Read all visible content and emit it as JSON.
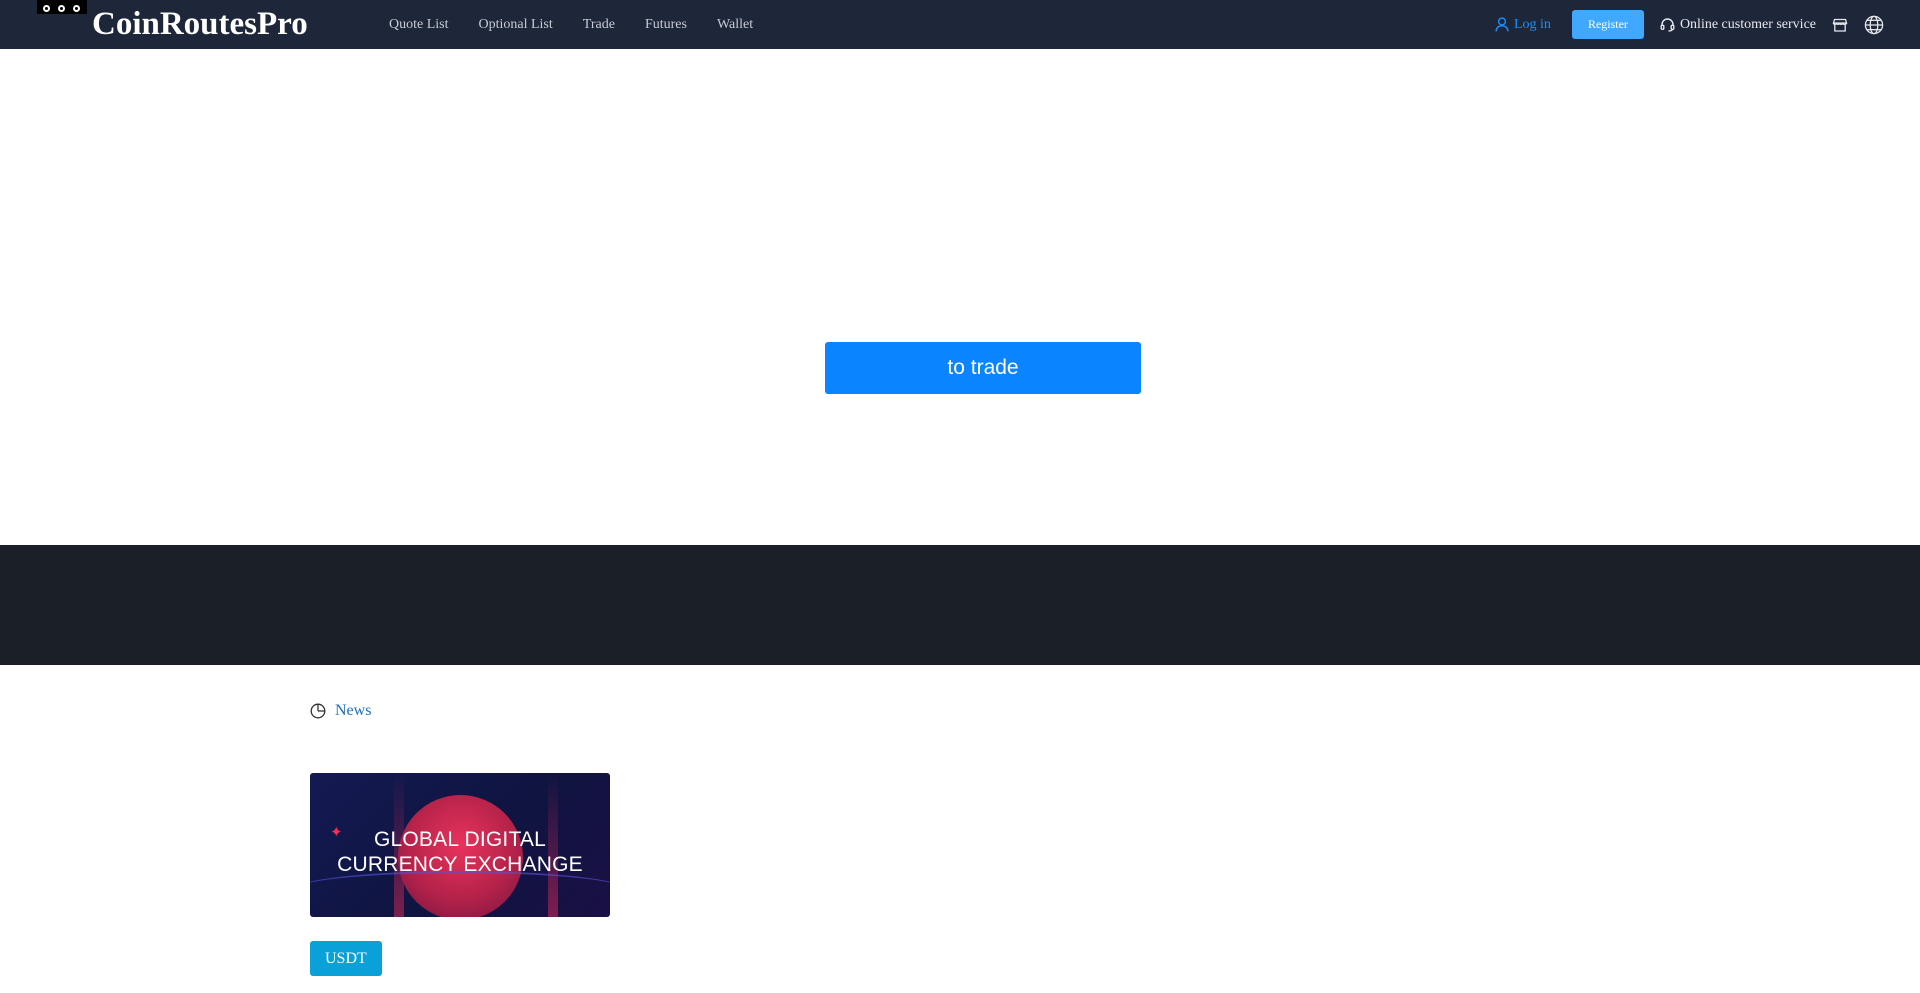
{
  "header": {
    "brand": "CoinRoutesPro",
    "nav": [
      {
        "label": "Quote List"
      },
      {
        "label": "Optional List"
      },
      {
        "label": "Trade"
      },
      {
        "label": "Futures"
      },
      {
        "label": "Wallet"
      }
    ],
    "login_label": "Log in",
    "register_label": "Register",
    "service_label": "Online customer service",
    "icons": {
      "user": "user-icon",
      "headset": "headset-icon",
      "store": "store-icon",
      "language": "globe-icon"
    }
  },
  "hero": {
    "cta_label": "to trade"
  },
  "news": {
    "title": "News",
    "icon": "clock-icon",
    "card": {
      "headline_line1": "GLOBAL DIGITAL",
      "headline_line2": "CURRENCY EXCHANGE"
    },
    "tag_label": "USDT"
  },
  "colors": {
    "header_bg": "#1e2639",
    "accent_blue": "#1890ff",
    "cta_blue": "#0a84ff",
    "dark_band": "#1b1f27",
    "tag_blue": "#0aa0d8",
    "news_link": "#1e6fb8"
  }
}
